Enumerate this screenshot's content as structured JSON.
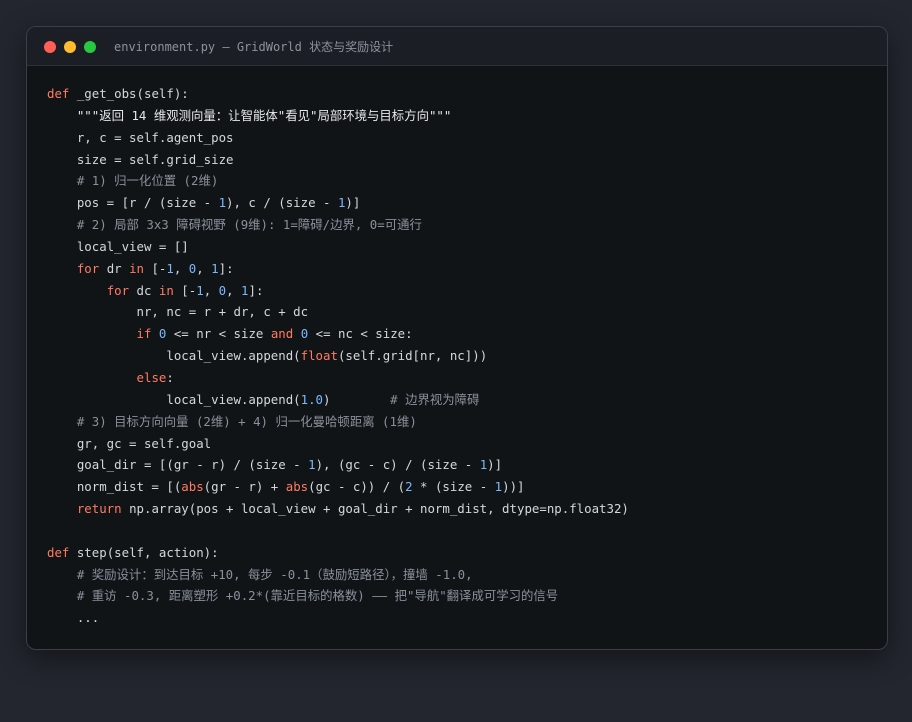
{
  "window": {
    "title": "environment.py — GridWorld 状态与奖励设计"
  },
  "code": {
    "lines": [
      {
        "tokens": [
          {
            "t": "def ",
            "c": "kw"
          },
          {
            "t": "_get_obs",
            "c": "fn"
          },
          {
            "t": "(self):",
            "c": ""
          }
        ]
      },
      {
        "tokens": [
          {
            "t": "    ",
            "c": ""
          },
          {
            "t": "\"\"\"返回 14 维观测向量：让智能体\"看见\"局部环境与目标方向\"\"\"",
            "c": "str"
          }
        ]
      },
      {
        "tokens": [
          {
            "t": "    r, c = self.agent_pos",
            "c": ""
          }
        ]
      },
      {
        "tokens": [
          {
            "t": "    size = self.grid_size",
            "c": ""
          }
        ]
      },
      {
        "tokens": [
          {
            "t": "    ",
            "c": ""
          },
          {
            "t": "# 1) 归一化位置 (2维)",
            "c": "cm"
          }
        ]
      },
      {
        "tokens": [
          {
            "t": "    pos = [r / (size - ",
            "c": ""
          },
          {
            "t": "1",
            "c": "num"
          },
          {
            "t": "), c / (size - ",
            "c": ""
          },
          {
            "t": "1",
            "c": "num"
          },
          {
            "t": ")]",
            "c": ""
          }
        ]
      },
      {
        "tokens": [
          {
            "t": "    ",
            "c": ""
          },
          {
            "t": "# 2) 局部 3x3 障碍视野 (9维): 1=障碍/边界, 0=可通行",
            "c": "cm"
          }
        ]
      },
      {
        "tokens": [
          {
            "t": "    local_view = []",
            "c": ""
          }
        ]
      },
      {
        "tokens": [
          {
            "t": "    ",
            "c": ""
          },
          {
            "t": "for",
            "c": "kw"
          },
          {
            "t": " dr ",
            "c": ""
          },
          {
            "t": "in",
            "c": "kw"
          },
          {
            "t": " [-",
            "c": ""
          },
          {
            "t": "1",
            "c": "num"
          },
          {
            "t": ", ",
            "c": ""
          },
          {
            "t": "0",
            "c": "num"
          },
          {
            "t": ", ",
            "c": ""
          },
          {
            "t": "1",
            "c": "num"
          },
          {
            "t": "]:",
            "c": ""
          }
        ]
      },
      {
        "tokens": [
          {
            "t": "        ",
            "c": ""
          },
          {
            "t": "for",
            "c": "kw"
          },
          {
            "t": " dc ",
            "c": ""
          },
          {
            "t": "in",
            "c": "kw"
          },
          {
            "t": " [-",
            "c": ""
          },
          {
            "t": "1",
            "c": "num"
          },
          {
            "t": ", ",
            "c": ""
          },
          {
            "t": "0",
            "c": "num"
          },
          {
            "t": ", ",
            "c": ""
          },
          {
            "t": "1",
            "c": "num"
          },
          {
            "t": "]:",
            "c": ""
          }
        ]
      },
      {
        "tokens": [
          {
            "t": "            nr, nc = r + dr, c + dc",
            "c": ""
          }
        ]
      },
      {
        "tokens": [
          {
            "t": "            ",
            "c": ""
          },
          {
            "t": "if",
            "c": "kw"
          },
          {
            "t": " ",
            "c": ""
          },
          {
            "t": "0",
            "c": "num"
          },
          {
            "t": " <= nr < size ",
            "c": ""
          },
          {
            "t": "and",
            "c": "kw"
          },
          {
            "t": " ",
            "c": ""
          },
          {
            "t": "0",
            "c": "num"
          },
          {
            "t": " <= nc < size:",
            "c": ""
          }
        ]
      },
      {
        "tokens": [
          {
            "t": "                local_view.append(",
            "c": ""
          },
          {
            "t": "float",
            "c": "kw"
          },
          {
            "t": "(self.grid[nr, nc]))",
            "c": ""
          }
        ]
      },
      {
        "tokens": [
          {
            "t": "            ",
            "c": ""
          },
          {
            "t": "else",
            "c": "kw"
          },
          {
            "t": ":",
            "c": ""
          }
        ]
      },
      {
        "tokens": [
          {
            "t": "                local_view.append(",
            "c": ""
          },
          {
            "t": "1.0",
            "c": "num"
          },
          {
            "t": ")        ",
            "c": ""
          },
          {
            "t": "# 边界视为障碍",
            "c": "cm"
          }
        ]
      },
      {
        "tokens": [
          {
            "t": "    ",
            "c": ""
          },
          {
            "t": "# 3) 目标方向向量 (2维) + 4) 归一化曼哈顿距离 (1维)",
            "c": "cm"
          }
        ]
      },
      {
        "tokens": [
          {
            "t": "    gr, gc = self.goal",
            "c": ""
          }
        ]
      },
      {
        "tokens": [
          {
            "t": "    goal_dir = [(gr - r) / (size - ",
            "c": ""
          },
          {
            "t": "1",
            "c": "num"
          },
          {
            "t": "), (gc - c) / (size - ",
            "c": ""
          },
          {
            "t": "1",
            "c": "num"
          },
          {
            "t": ")]",
            "c": ""
          }
        ]
      },
      {
        "tokens": [
          {
            "t": "    norm_dist = [(",
            "c": ""
          },
          {
            "t": "abs",
            "c": "kw"
          },
          {
            "t": "(gr - r) + ",
            "c": ""
          },
          {
            "t": "abs",
            "c": "kw"
          },
          {
            "t": "(gc - c)) / (",
            "c": ""
          },
          {
            "t": "2",
            "c": "num"
          },
          {
            "t": " * (size - ",
            "c": ""
          },
          {
            "t": "1",
            "c": "num"
          },
          {
            "t": "))]",
            "c": ""
          }
        ]
      },
      {
        "tokens": [
          {
            "t": "    ",
            "c": ""
          },
          {
            "t": "return",
            "c": "kw"
          },
          {
            "t": " np.array(pos + local_view + goal_dir + norm_dist, dtype=np.float32)",
            "c": ""
          }
        ]
      },
      {
        "tokens": [
          {
            "t": "",
            "c": ""
          }
        ]
      },
      {
        "tokens": [
          {
            "t": "def ",
            "c": "kw"
          },
          {
            "t": "step",
            "c": "fn"
          },
          {
            "t": "(self, action):",
            "c": ""
          }
        ]
      },
      {
        "tokens": [
          {
            "t": "    ",
            "c": ""
          },
          {
            "t": "# 奖励设计：到达目标 +10, 每步 -0.1（鼓励短路径），撞墙 -1.0,",
            "c": "cm"
          }
        ]
      },
      {
        "tokens": [
          {
            "t": "    ",
            "c": ""
          },
          {
            "t": "# 重访 -0.3, 距离塑形 +0.2*(靠近目标的格数) —— 把\"导航\"翻译成可学习的信号",
            "c": "cm"
          }
        ]
      },
      {
        "tokens": [
          {
            "t": "    ...",
            "c": ""
          }
        ]
      }
    ]
  }
}
